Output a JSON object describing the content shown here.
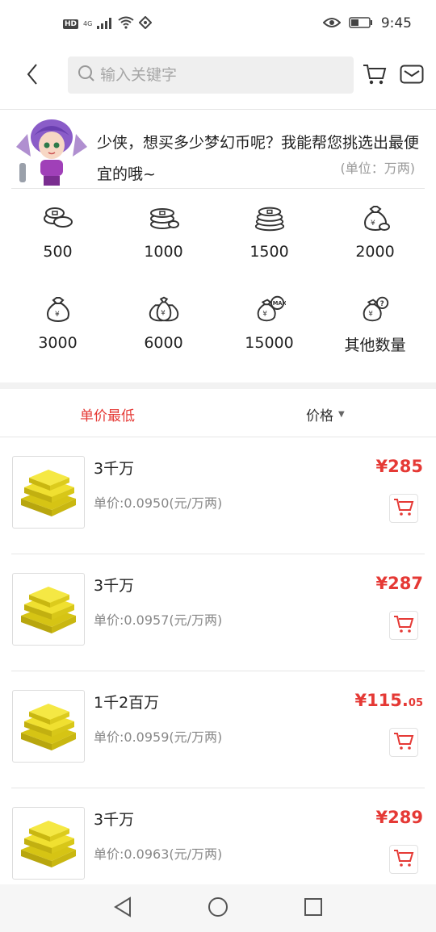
{
  "status_bar": {
    "hd": "HD",
    "network": "4G",
    "time": "9:45"
  },
  "header": {
    "search_placeholder": "输入关键字",
    "back_icon": "chevron-left-icon",
    "cart_icon": "cart-icon",
    "mail_icon": "mail-icon"
  },
  "banner": {
    "message": "少侠，想买多少梦幻币呢？我能帮您挑选出最便宜的哦~",
    "unit_note": "(单位：万两)"
  },
  "quantities": [
    {
      "label": "500",
      "icon": "coins-icon"
    },
    {
      "label": "1000",
      "icon": "coin-stack-icon"
    },
    {
      "label": "1500",
      "icon": "coin-pile-icon"
    },
    {
      "label": "2000",
      "icon": "money-bag-icon"
    },
    {
      "label": "3000",
      "icon": "money-bag-icon"
    },
    {
      "label": "6000",
      "icon": "money-bags-icon"
    },
    {
      "label": "15000",
      "icon": "money-bag-max-icon"
    },
    {
      "label": "其他数量",
      "icon": "money-bag-question-icon"
    }
  ],
  "sort": {
    "lowest_label": "单价最低",
    "price_label": "价格",
    "active_color": "#e53935"
  },
  "items": [
    {
      "title": "3千万",
      "unit_price": "单价:0.0950(元/万两)",
      "price": "¥285",
      "cents": ""
    },
    {
      "title": "3千万",
      "unit_price": "单价:0.0957(元/万两)",
      "price": "¥287",
      "cents": ""
    },
    {
      "title": "1千2百万",
      "unit_price": "单价:0.0959(元/万两)",
      "price": "¥115.",
      "cents": "05"
    },
    {
      "title": "3千万",
      "unit_price": "单价:0.0963(元/万两)",
      "price": "¥289",
      "cents": ""
    }
  ],
  "colors": {
    "accent": "#e53935",
    "gold": "#e8d21a"
  }
}
